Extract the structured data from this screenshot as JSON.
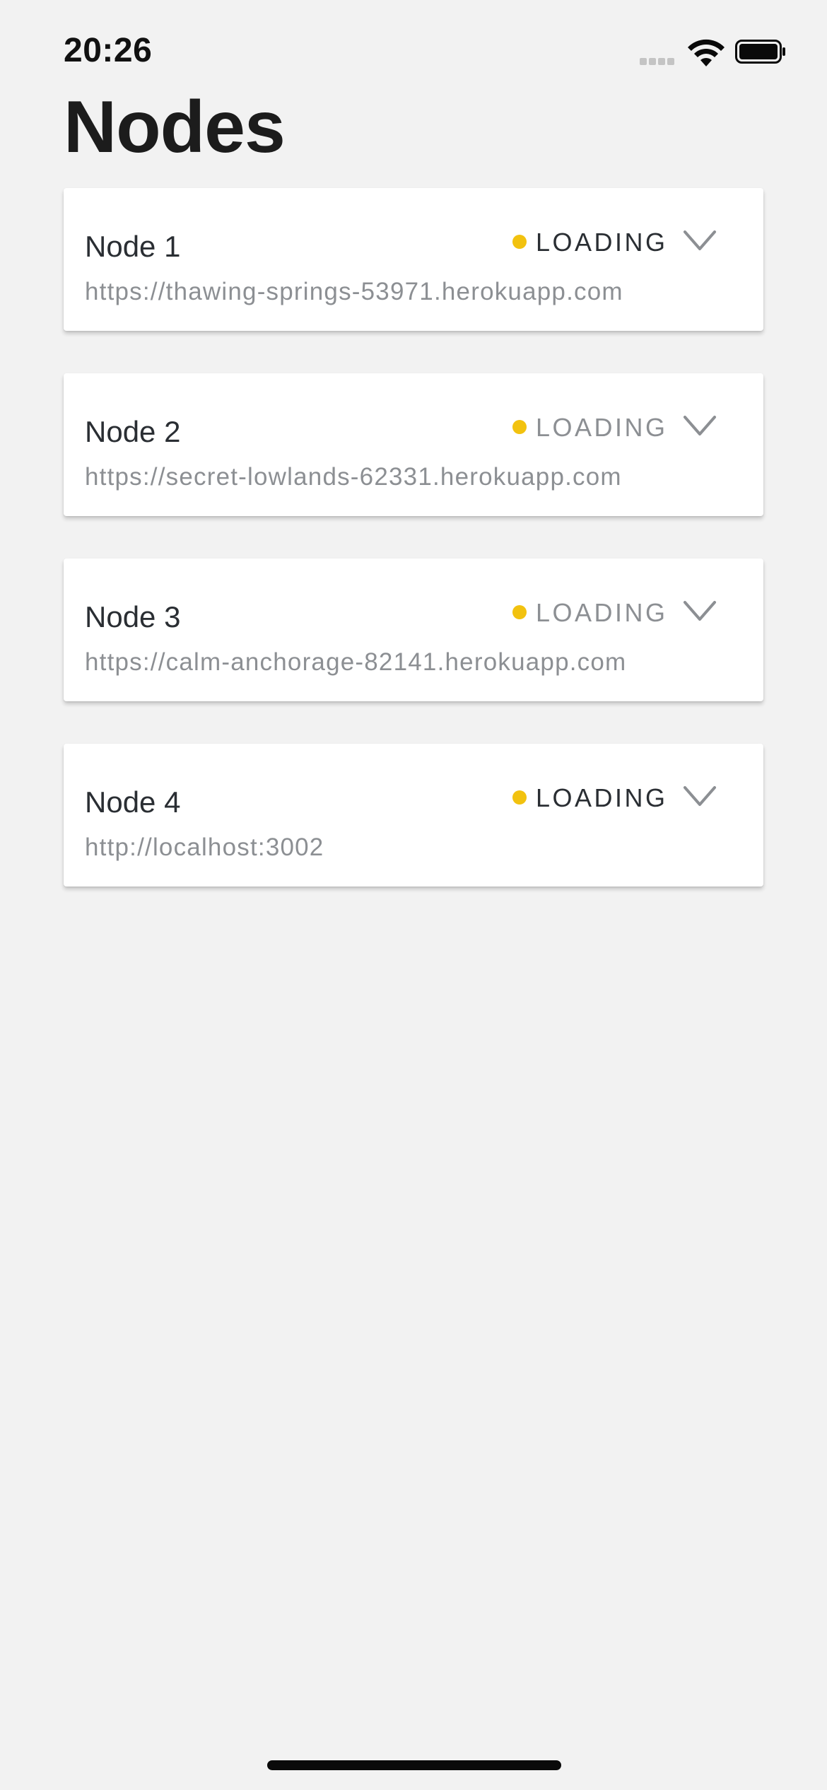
{
  "status_bar": {
    "time": "20:26"
  },
  "page": {
    "title": "Nodes"
  },
  "colors": {
    "loading_dot": "#f2c20f",
    "background": "#f2f2f2",
    "card": "#ffffff"
  },
  "nodes": [
    {
      "name": "Node 1",
      "url": "https://thawing-springs-53971.herokuapp.com",
      "status": "LOADING",
      "status_tone": "dark"
    },
    {
      "name": "Node 2",
      "url": "https://secret-lowlands-62331.herokuapp.com",
      "status": "LOADING",
      "status_tone": "grey"
    },
    {
      "name": "Node 3",
      "url": "https://calm-anchorage-82141.herokuapp.com",
      "status": "LOADING",
      "status_tone": "grey"
    },
    {
      "name": "Node 4",
      "url": "http://localhost:3002",
      "status": "LOADING",
      "status_tone": "dark"
    }
  ]
}
